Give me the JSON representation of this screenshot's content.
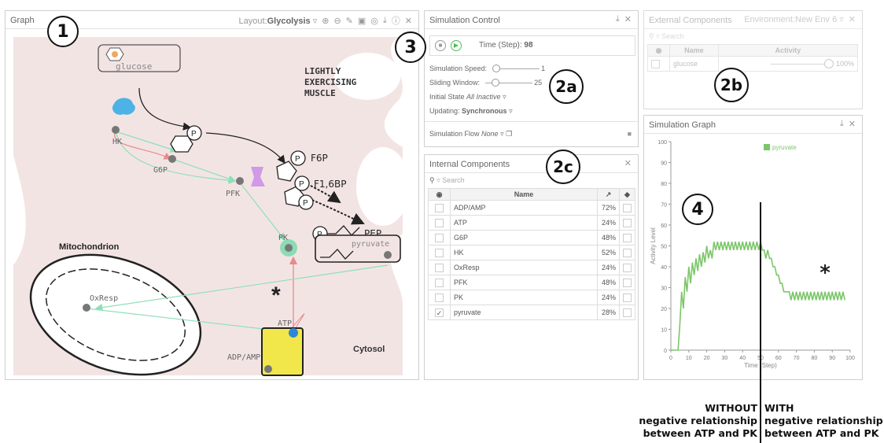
{
  "graph": {
    "title": "Graph",
    "layout_prefix": "Layout:",
    "layout_value": "Glycolysis",
    "badge": "1",
    "context_label": "LIGHTLY EXERCISING MUSCLE",
    "context_lines": [
      "LIGHTLY",
      "EXERCISING",
      "MUSCLE"
    ],
    "mitochondrion_label": "Mitochondrion",
    "cytosol_label": "Cytosol",
    "nodes": {
      "glucose": "glucose",
      "hk": "HK",
      "g6p": "G6P",
      "pfk": "PFK",
      "f6p": "F6P",
      "f16bp": "F1,6BP",
      "pep": "PEP",
      "pk": "PK",
      "pyruvate": "pyruvate",
      "oxresp": "OxResp",
      "atp": "ATP",
      "adpamp": "ADP/AMP",
      "phosphate": "P"
    },
    "asterisk": "*"
  },
  "simulation_control": {
    "title": "Simulation Control",
    "badge_main": "3",
    "badge_sub": "2a",
    "time_label": "Time (Step):",
    "time_value": "98",
    "speed_label": "Simulation Speed:",
    "speed_value": "1",
    "window_label": "Sliding Window:",
    "window_value": "25",
    "initial_state_label": "Initial State",
    "initial_state_value": "All Inactive",
    "updating_label": "Updating:",
    "updating_value": "Synchronous",
    "flow_label": "Simulation Flow",
    "flow_value": "None"
  },
  "external_components": {
    "title": "External Components",
    "environment_label": "Environment:",
    "environment_value": "New Env 6",
    "badge": "2b",
    "search_placeholder": "Search",
    "col_name": "Name",
    "col_activity": "Activity",
    "rows": [
      {
        "name": "glucose",
        "activity": "100",
        "unit": "%"
      }
    ]
  },
  "internal_components": {
    "title": "Internal Components",
    "badge": "2c",
    "search_placeholder": "Search",
    "col_name": "Name",
    "rows": [
      {
        "name": "ADP/AMP",
        "value": "72%",
        "checked": false
      },
      {
        "name": "ATP",
        "value": "24%",
        "checked": false
      },
      {
        "name": "G6P",
        "value": "48%",
        "checked": false
      },
      {
        "name": "HK",
        "value": "52%",
        "checked": false
      },
      {
        "name": "OxResp",
        "value": "24%",
        "checked": false
      },
      {
        "name": "PFK",
        "value": "48%",
        "checked": false
      },
      {
        "name": "PK",
        "value": "24%",
        "checked": false
      },
      {
        "name": "pyruvate",
        "value": "28%",
        "checked": true
      }
    ]
  },
  "simulation_graph": {
    "title": "Simulation Graph",
    "badge": "4",
    "asterisk": "*"
  },
  "chart_data": {
    "type": "line",
    "xlabel": "Time (Step)",
    "ylabel": "Activity Level",
    "xlim": [
      0,
      100
    ],
    "ylim": [
      0,
      100
    ],
    "xticks": [
      0,
      10,
      20,
      30,
      40,
      50,
      60,
      70,
      80,
      90,
      100
    ],
    "yticks": [
      0,
      10,
      20,
      30,
      40,
      50,
      60,
      70,
      80,
      90,
      100
    ],
    "series": [
      {
        "name": "pyruvate",
        "color": "#7cc66a",
        "x": [
          0,
          4,
          5,
          6,
          7,
          8,
          9,
          10,
          11,
          12,
          13,
          14,
          15,
          16,
          17,
          18,
          19,
          20,
          21,
          22,
          23,
          24,
          25,
          26,
          27,
          28,
          29,
          30,
          31,
          32,
          33,
          34,
          35,
          36,
          37,
          38,
          39,
          40,
          41,
          42,
          43,
          44,
          45,
          46,
          47,
          48,
          49,
          50,
          51,
          52,
          53,
          54,
          55,
          56,
          57,
          58,
          59,
          60,
          61,
          62,
          63,
          64,
          65,
          66,
          67,
          68,
          69,
          70,
          71,
          72,
          73,
          74,
          75,
          76,
          77,
          78,
          79,
          80,
          81,
          82,
          83,
          84,
          85,
          86,
          87,
          88,
          89,
          90,
          91,
          92,
          93,
          94,
          95,
          96,
          97
        ],
        "y": [
          0,
          0,
          12,
          28,
          20,
          35,
          28,
          40,
          32,
          42,
          36,
          44,
          38,
          46,
          40,
          47,
          42,
          50,
          44,
          48,
          44,
          52,
          48,
          52,
          48,
          52,
          48,
          52,
          48,
          52,
          48,
          52,
          48,
          52,
          48,
          52,
          48,
          52,
          48,
          52,
          48,
          52,
          48,
          52,
          48,
          52,
          48,
          52,
          48,
          48,
          44,
          48,
          44,
          44,
          40,
          40,
          36,
          36,
          32,
          32,
          28,
          28,
          28,
          28,
          24,
          28,
          24,
          28,
          24,
          28,
          24,
          28,
          24,
          28,
          24,
          28,
          24,
          28,
          24,
          28,
          24,
          28,
          24,
          28,
          24,
          28,
          24,
          28,
          24,
          28,
          24,
          28,
          24,
          28,
          24
        ]
      }
    ],
    "annotations": {
      "left": [
        "WITHOUT",
        "negative relationship",
        "between ATP and PK"
      ],
      "right": [
        "WITH",
        "negative relationship",
        "between ATP and PK"
      ]
    }
  },
  "colors": {
    "line_green": "#7cc66a",
    "pink_bg": "#f3e4e4",
    "atp_yellow": "#f2e74a",
    "pk_glow": "#5cd9a0",
    "edge_red": "#e88b8b",
    "edge_green": "#8ee0b8"
  }
}
